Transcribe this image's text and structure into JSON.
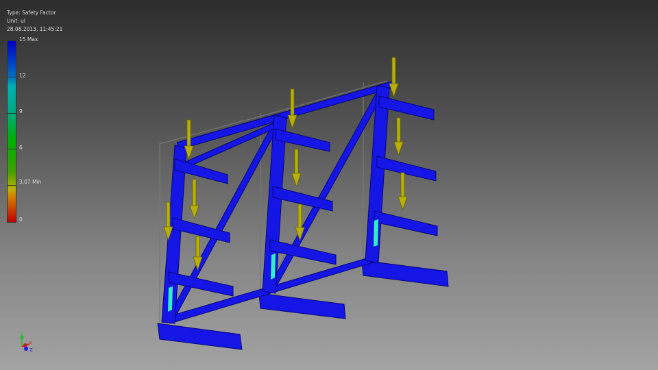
{
  "header": {
    "type": "Type: Safety Factor",
    "unit": "Unit: ul",
    "timestamp": "28.08.2013, 11:45:21"
  },
  "legend": {
    "labels": [
      "15 Max",
      "12",
      "9",
      "6",
      "3,07 Min",
      "0"
    ],
    "max": 15,
    "min": 0,
    "min_value": 3.07,
    "colors": [
      "#0000c0",
      "#00b0b0",
      "#00b000",
      "#c0b000",
      "#c00000"
    ]
  },
  "triad": {
    "x": "X",
    "y": "Y",
    "z": "Z"
  },
  "colors": {
    "structure": "#1515e6",
    "load_arrow": "#b8b000",
    "hotspot": "#30f0c0"
  }
}
